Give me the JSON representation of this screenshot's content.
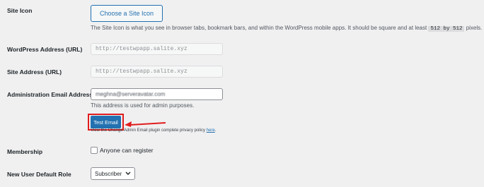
{
  "site_icon": {
    "label": "Site Icon",
    "button": "Choose a Site Icon",
    "desc_before": "The Site Icon is what you see in browser tabs, bookmark bars, and within the WordPress mobile apps. It should be square and at least",
    "size_w": "512 by 512",
    "desc_after": "pixels."
  },
  "wordpress_address": {
    "label": "WordPress Address (URL)",
    "value": "http://testwpapp.salite.xyz"
  },
  "site_address": {
    "label": "Site Address (URL)",
    "value": "http://testwpapp.salite.xyz"
  },
  "admin_email": {
    "label": "Administration Email Address",
    "value": "meghna@serveravatar.com",
    "desc": "This address is used for admin purposes.",
    "test_button": "Test Email",
    "note_before": "View the Change Admin Email plugin complete privacy policy",
    "note_link": "here",
    "note_after": "."
  },
  "membership": {
    "label": "Membership",
    "checkbox_label": "Anyone can register"
  },
  "default_role": {
    "label": "New User Default Role",
    "selected": "Subscriber"
  },
  "colors": {
    "accent": "#2271b1",
    "highlight": "#e11d1d"
  }
}
